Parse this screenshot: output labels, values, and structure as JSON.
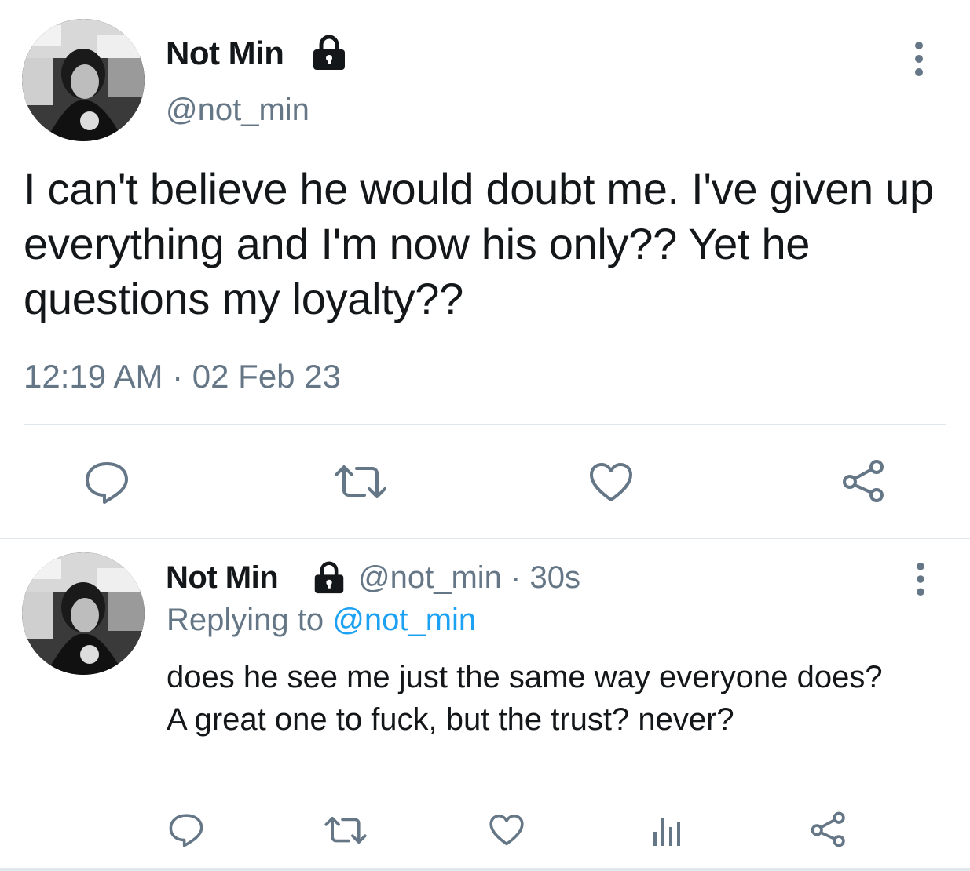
{
  "main_tweet": {
    "display_name": "Not Min",
    "handle": "@not_min",
    "text": "I can't believe he would doubt me. I've given up everything and I'm now his only?? Yet he questions my loyalty??",
    "timestamp": "12:19 AM · 02 Feb 23",
    "icons": [
      "lock-icon",
      "more-vertical-icon",
      "reply-icon",
      "retweet-icon",
      "like-icon",
      "share-icon"
    ]
  },
  "reply_tweet": {
    "display_name": "Not Min",
    "handle": "@not_min",
    "separator": "·",
    "time": "30s",
    "replying_prefix": "Replying to",
    "replying_to": "@not_min",
    "text": "does he see me just the same way everyone does?\nA great one to fuck, but the trust? never?",
    "icons": [
      "lock-icon",
      "more-vertical-icon",
      "reply-icon",
      "retweet-icon",
      "like-icon",
      "analytics-icon",
      "share-icon"
    ]
  },
  "colors": {
    "text": "#14171a",
    "secondary": "#657786",
    "link": "#1da1f2",
    "divider": "#e1e8ed"
  }
}
